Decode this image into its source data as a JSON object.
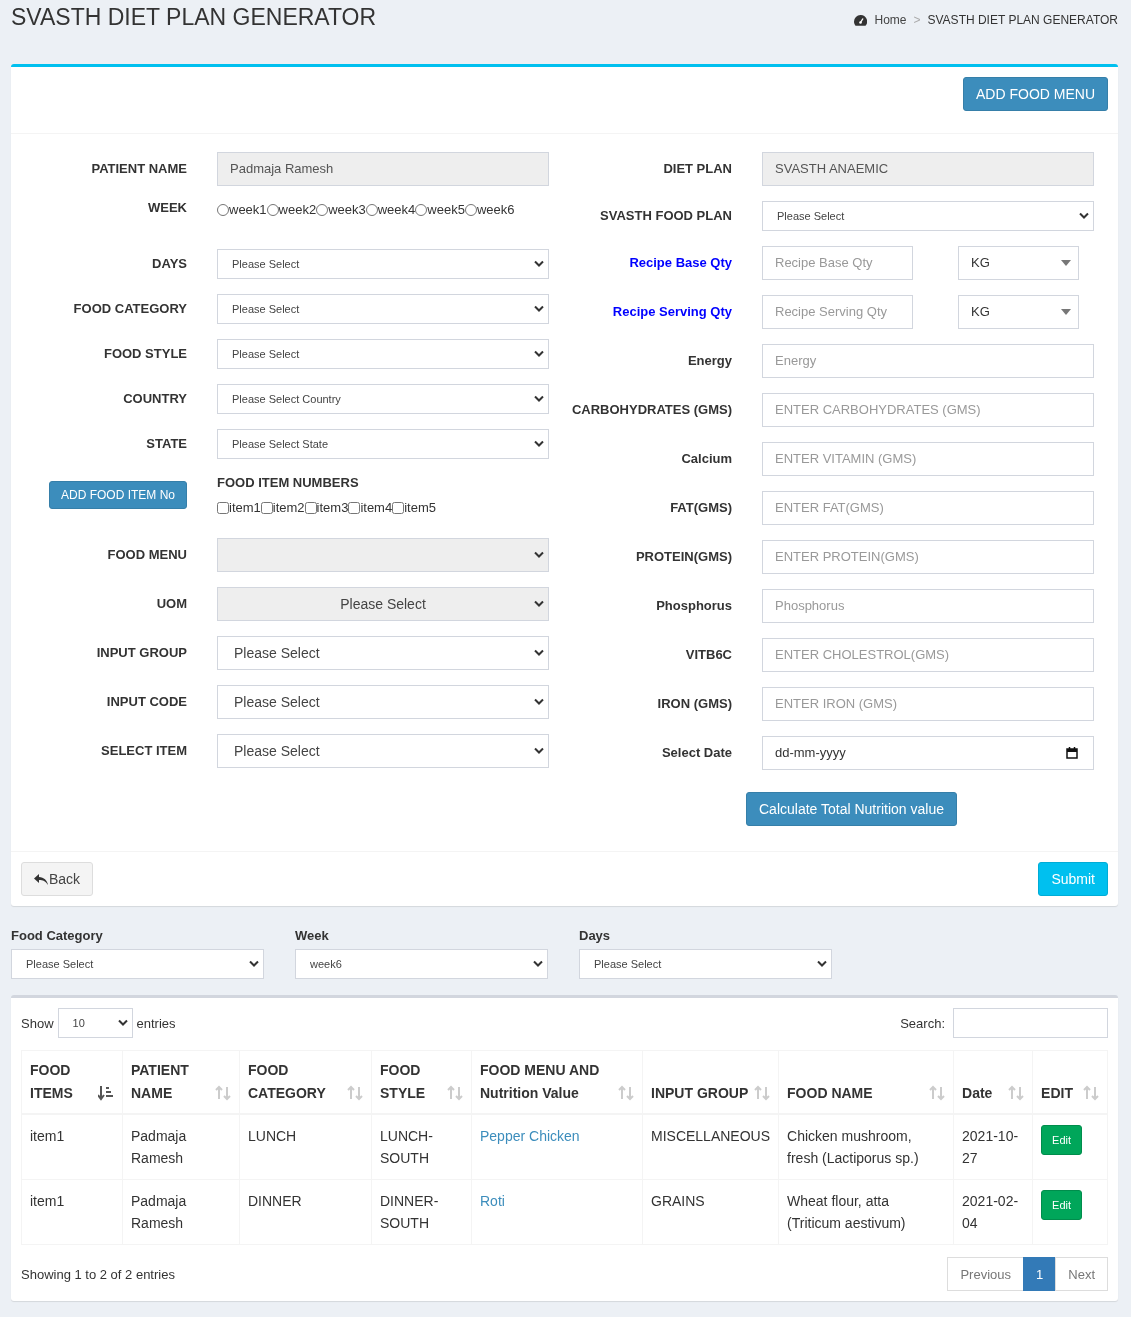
{
  "header": {
    "title": "SVASTH DIET PLAN GENERATOR",
    "breadcrumb": [
      "Home",
      "SVASTH DIET PLAN GENERATOR"
    ],
    "separator": ">"
  },
  "add_food_menu_button": "ADD FOOD MENU",
  "left_fields": [
    {
      "kind": "readonly",
      "label": "PATIENT NAME",
      "value": "Padmaja Ramesh"
    },
    {
      "kind": "radio",
      "label": "WEEK",
      "options": [
        {
          "label": "week1",
          "selected": false
        },
        {
          "label": "week2",
          "selected": false
        },
        {
          "label": "week3",
          "selected": false
        },
        {
          "label": "week4",
          "selected": false
        },
        {
          "label": "week5",
          "selected": false
        },
        {
          "label": "week6",
          "selected": false
        }
      ]
    },
    {
      "kind": "compact",
      "label": "DAYS",
      "value": "Please Select"
    },
    {
      "kind": "compact",
      "label": "FOOD CATEGORY",
      "value": "Please Select"
    },
    {
      "kind": "compact",
      "label": "FOOD STYLE",
      "value": "Please Select"
    },
    {
      "kind": "compact",
      "label": "COUNTRY",
      "value": "Please Select Country"
    },
    {
      "kind": "compact",
      "label": "STATE",
      "value": "Please Select State"
    },
    {
      "kind": "checks",
      "button": "ADD FOOD ITEM No",
      "label": "FOOD ITEM NUMBERS",
      "options": [
        {
          "label": "item1",
          "checked": false
        },
        {
          "label": "item2",
          "checked": false
        },
        {
          "label": "item3",
          "checked": false
        },
        {
          "label": "item4",
          "checked": false
        },
        {
          "label": "item5",
          "checked": false
        }
      ]
    },
    {
      "kind": "select",
      "label": "FOOD MENU",
      "disabled": true
    },
    {
      "kind": "select",
      "label": "UOM",
      "value": "Please Select",
      "disabled": true
    },
    {
      "kind": "select",
      "label": "INPUT GROUP",
      "value": "Please Select",
      "disabled": false
    },
    {
      "kind": "select",
      "label": "INPUT CODE",
      "value": "Please Select",
      "disabled": false
    },
    {
      "kind": "select",
      "label": "SELECT ITEM",
      "value": "Please Select",
      "disabled": false
    }
  ],
  "right_fields": [
    {
      "kind": "readonly",
      "label": "DIET PLAN",
      "value": "SVASTH ANAEMIC"
    },
    {
      "kind": "compact",
      "label": "SVASTH FOOD PLAN",
      "value": "Please Select"
    },
    {
      "kind": "qty",
      "label": "Recipe Base Qty",
      "placeholder": "Recipe Base Qty",
      "unit": "KG"
    },
    {
      "kind": "qty",
      "label": "Recipe Serving Qty",
      "placeholder": "Recipe Serving Qty",
      "unit": "KG"
    },
    {
      "kind": "input",
      "label": "Energy",
      "placeholder": "Energy"
    },
    {
      "kind": "input",
      "label": "CARBOHYDRATES (GMS)",
      "placeholder": "ENTER CARBOHYDRATES (GMS)"
    },
    {
      "kind": "input",
      "label": "Calcium",
      "placeholder": "ENTER VITAMIN (GMS)"
    },
    {
      "kind": "input",
      "label": "FAT(GMS)",
      "placeholder": "ENTER FAT(GMS)"
    },
    {
      "kind": "input",
      "label": "PROTEIN(GMS)",
      "placeholder": "ENTER PROTEIN(GMS)"
    },
    {
      "kind": "input",
      "label": "Phosphorus",
      "placeholder": "Phosphorus"
    },
    {
      "kind": "input",
      "label": "VITB6C",
      "placeholder": "ENTER CHOLESTROL(GMS)"
    },
    {
      "kind": "input",
      "label": "IRON (GMS)",
      "placeholder": "ENTER IRON (GMS)"
    },
    {
      "kind": "date",
      "label": "Select Date",
      "placeholder": "dd-mm-yyyy"
    }
  ],
  "calculate_button": "Calculate Total Nutrition value",
  "back_button": "Back",
  "submit_button": "Submit",
  "filters": [
    {
      "label": "Food Category",
      "value": "Please Select"
    },
    {
      "label": "Week",
      "value": "week6"
    },
    {
      "label": "Days",
      "value": "Please Select"
    }
  ],
  "table": {
    "show_label": "Show",
    "page_length": "10",
    "entries_label": "entries",
    "search_label": "Search:",
    "columns": [
      {
        "label": "FOOD ITEMS",
        "sorted": true
      },
      {
        "label": "PATIENT NAME",
        "sorted": false
      },
      {
        "label": "FOOD CATEGORY",
        "sorted": false
      },
      {
        "label": "FOOD STYLE",
        "sorted": false
      },
      {
        "label": "FOOD MENU AND Nutrition Value",
        "sorted": false
      },
      {
        "label": "INPUT GROUP",
        "sorted": false
      },
      {
        "label": "FOOD NAME",
        "sorted": false
      },
      {
        "label": "Date",
        "sorted": false
      },
      {
        "label": "EDIT",
        "sorted": false
      }
    ],
    "rows": [
      {
        "food_items": "item1",
        "patient_name": "Padmaja Ramesh",
        "food_category": "LUNCH",
        "food_style": "LUNCH-SOUTH",
        "food_menu": "Pepper Chicken",
        "input_group": "MISCELLANEOUS",
        "food_name": "Chicken mushroom, fresh (Lactiporus sp.)",
        "date": "2021-10-27",
        "edit": "Edit"
      },
      {
        "food_items": "item1",
        "patient_name": "Padmaja Ramesh",
        "food_category": "DINNER",
        "food_style": "DINNER-SOUTH",
        "food_menu": "Roti",
        "input_group": "GRAINS",
        "food_name": "Wheat flour, atta (Triticum aestivum)",
        "date": "2021-02-04",
        "edit": "Edit"
      }
    ],
    "info": "Showing 1 to 2 of 2 entries",
    "pagination": {
      "previous": {
        "label": "Previous",
        "disabled": true
      },
      "pages": [
        {
          "label": "1",
          "selected": true
        }
      ],
      "next": {
        "label": "Next",
        "disabled": true
      }
    }
  }
}
